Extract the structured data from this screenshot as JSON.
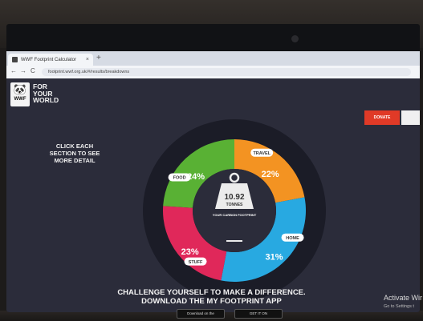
{
  "browser": {
    "tab_title": "WWF Footprint Calculator",
    "tab_close": "×",
    "new_tab": "+",
    "back": "←",
    "forward": "→",
    "reload": "C",
    "url": "footprint.wwf.org.uk/#/results/breakdowns"
  },
  "site": {
    "logo_wwf": "WWF",
    "logo_lines": [
      "FOR",
      "YOUR",
      "WORLD"
    ],
    "donate_label": "DONATE",
    "second_button": "",
    "hint": "CLICK EACH SECTION TO SEE MORE DETAIL"
  },
  "chart_data": {
    "type": "pie",
    "categories": [
      "Food",
      "Travel",
      "Home",
      "Stuff"
    ],
    "labels": [
      "FOOD",
      "TRAVEL",
      "HOME",
      "STUFF"
    ],
    "values": [
      24,
      22,
      31,
      23
    ],
    "value_labels": [
      "24%",
      "22%",
      "31%",
      "23%"
    ],
    "colors": [
      "#59b134",
      "#f39322",
      "#28a9e1",
      "#e0285a"
    ],
    "center_value": "10.92",
    "center_unit": "TONNES",
    "center_caption": "YOUR CARBON FOOTPRINT"
  },
  "cta": {
    "line1": "CHALLENGE YOURSELF TO MAKE A DIFFERENCE.",
    "line2": "DOWNLOAD THE MY FOOTPRINT APP",
    "app_store": "Download on the",
    "google_play": "GET IT ON"
  },
  "os_overlay": {
    "activate_title": "Activate Wir",
    "activate_sub": "Go to Settings t"
  }
}
